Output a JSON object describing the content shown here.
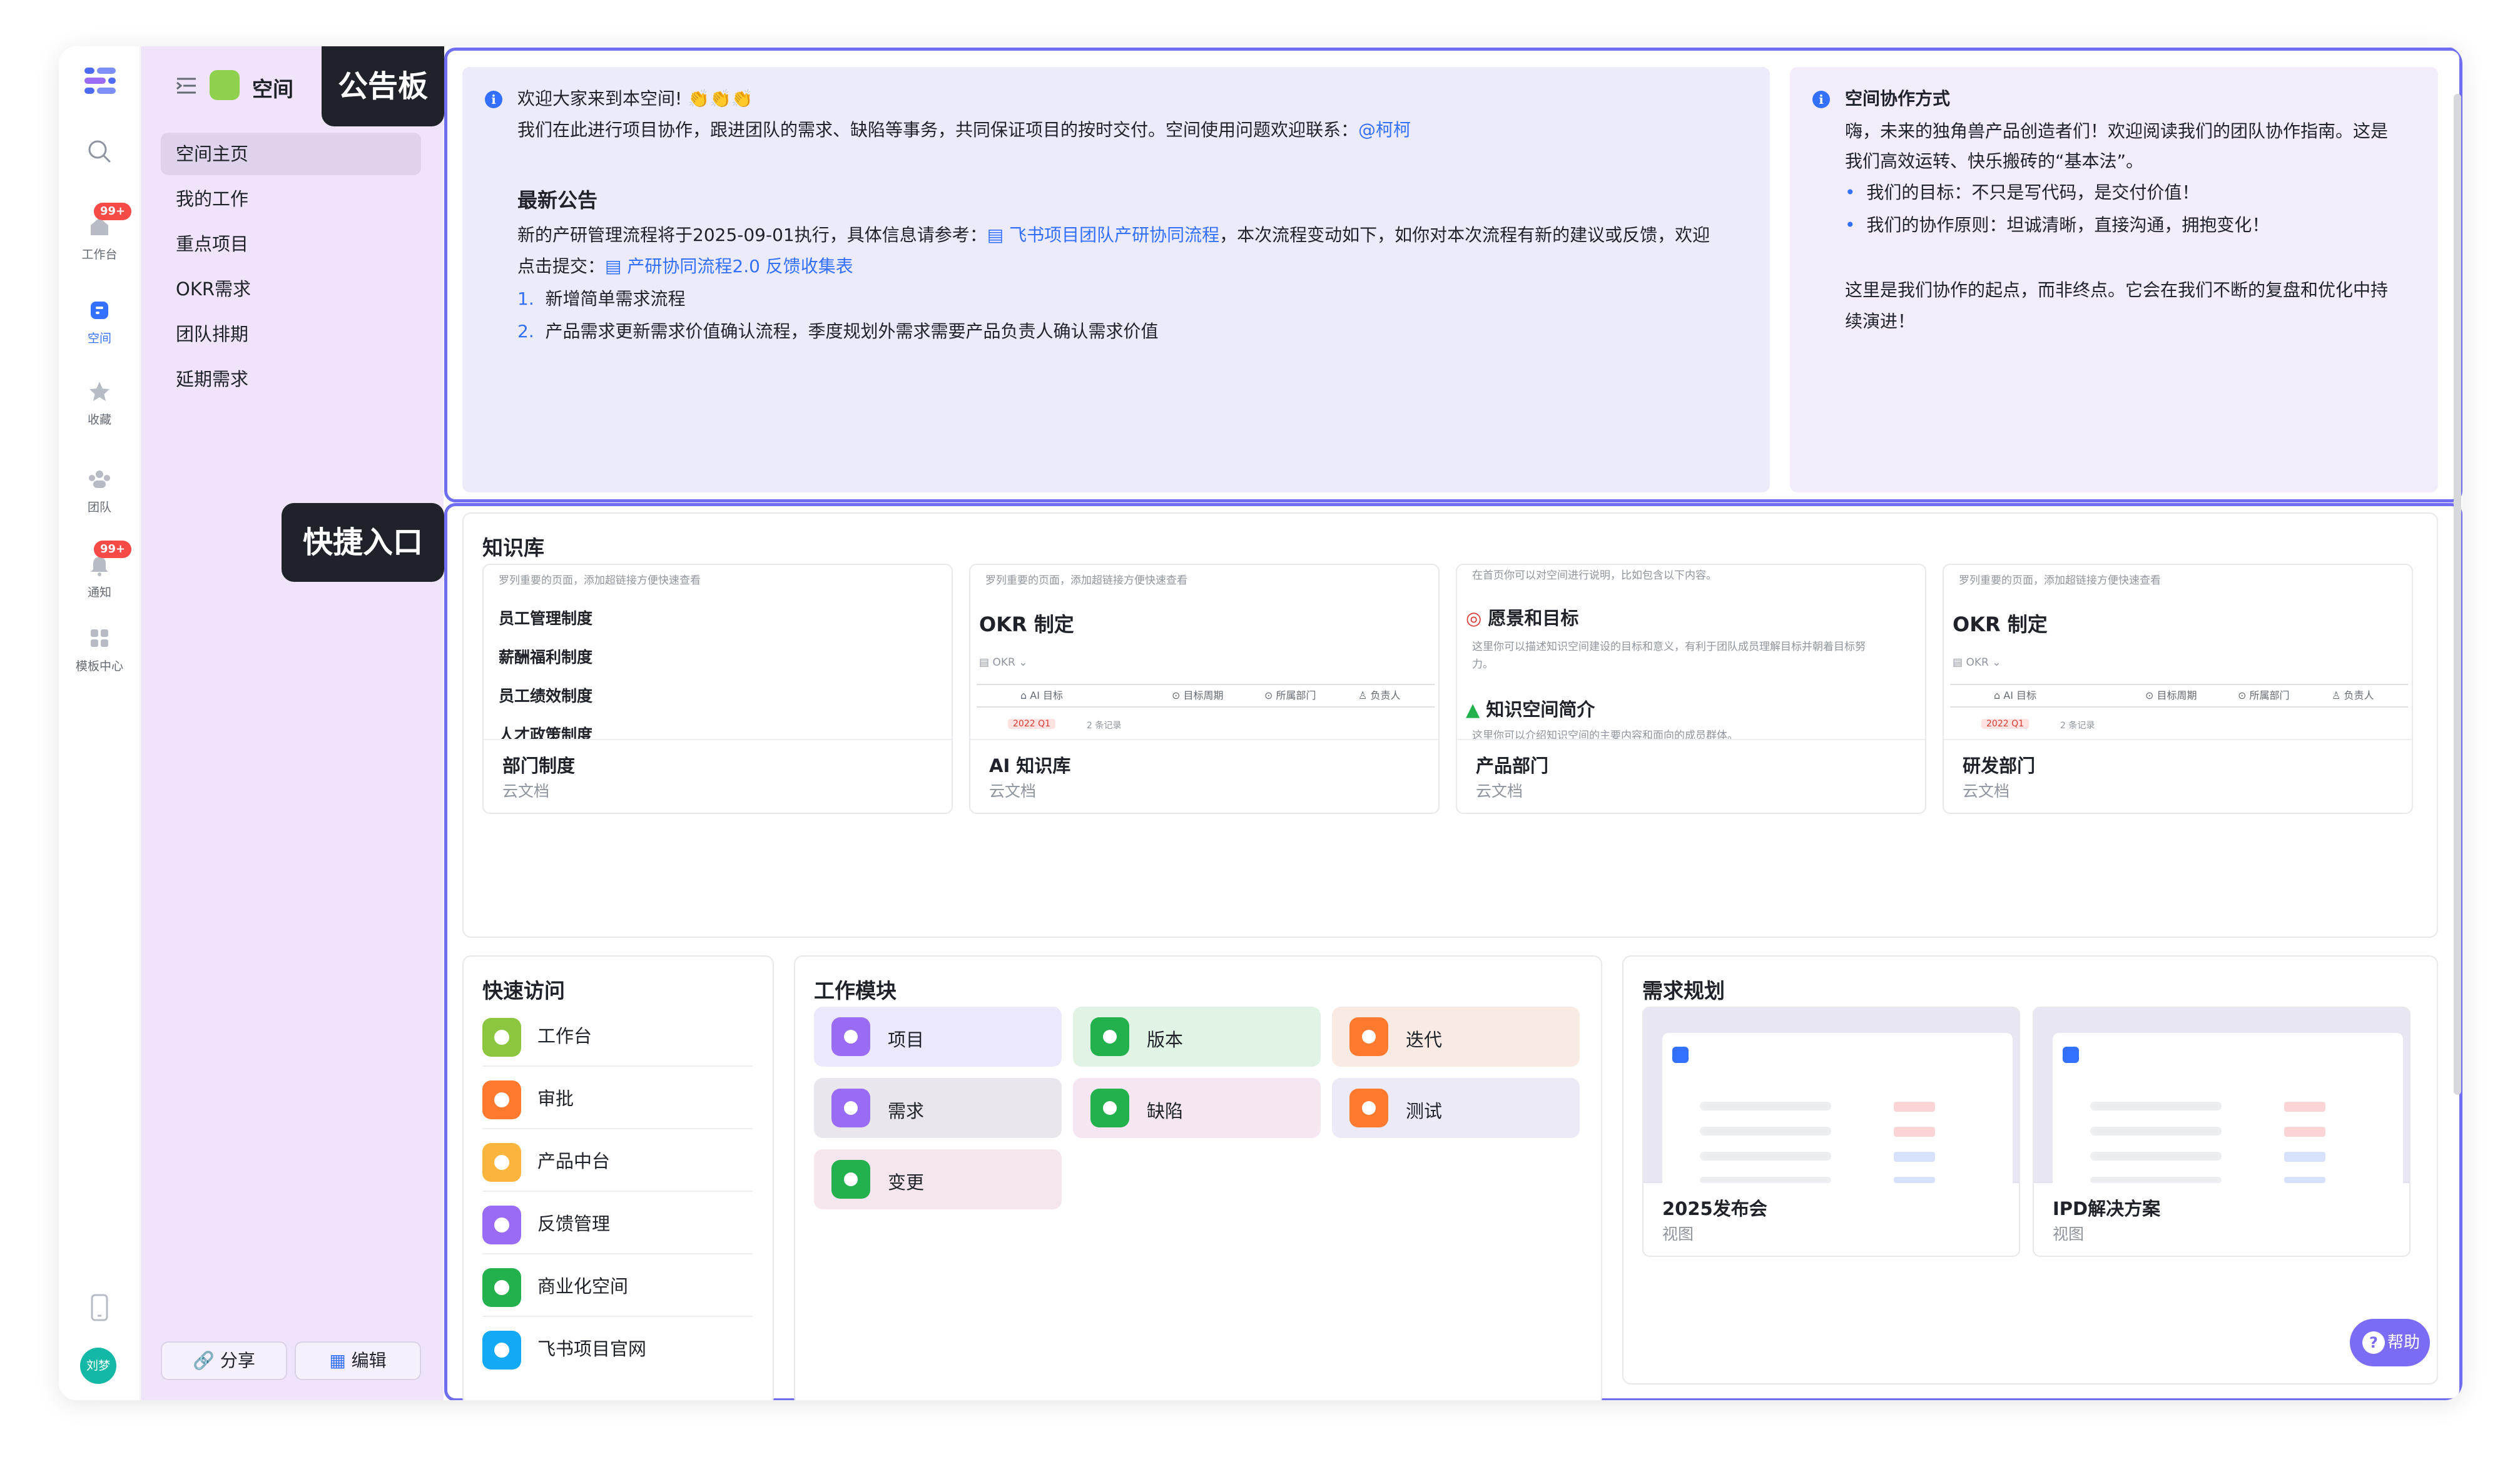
{
  "rail": {
    "items": [
      {
        "label": "工作台",
        "badge": "99+"
      },
      {
        "label": "空间"
      },
      {
        "label": "收藏"
      },
      {
        "label": "团队"
      },
      {
        "label": "通知",
        "badge": "99+"
      },
      {
        "label": "模板中心"
      }
    ],
    "avatar": "刘梦",
    "active_color": "#3370ff"
  },
  "sidebar": {
    "space_name": "空间",
    "items": [
      "空间主页",
      "我的工作",
      "重点项目",
      "OKR需求",
      "团队排期",
      "延期需求"
    ],
    "share_label": "分享",
    "edit_label": "编辑",
    "bg_color": "#efe4f9"
  },
  "tooltips": {
    "board": "公告板",
    "quick": "快捷入口"
  },
  "announcement": {
    "left": {
      "welcome": "欢迎大家来到本空间! 👏👏👏",
      "intro": "我们在此进行项目协作，跟进团队的需求、缺陷等事务，共同保证项目的按时交付。空间使用问题欢迎联系：",
      "contact": "@柯柯",
      "heading": "最新公告",
      "notice_1": "新的产研管理流程将于2025-09-01执行，具体信息请参考：",
      "doc_link": "飞书项目团队产研协同流程",
      "notice_2": "，本次流程变动如下，如你对本次流程有新的建议或反馈，欢迎",
      "notice_3": "点击提交：",
      "form_link": "产研协同流程2.0 反馈收集表",
      "list": [
        {
          "num": "1.",
          "text": "新增简单需求流程"
        },
        {
          "num": "2.",
          "text": "产品需求更新需求价值确认流程，季度规划外需求需要产品负责人确认需求价值"
        }
      ]
    },
    "right": {
      "title": "空间协作方式",
      "p1": "嗨，未来的独角兽产品创造者们！欢迎阅读我们的团队协作指南。这是",
      "p2": "我们高效运转、快乐搬砖的“基本法”。",
      "bullets": [
        "我们的目标：不只是写代码，是交付价值！",
        "我们的协作原则：坦诚清晰，直接沟通，拥抱变化！"
      ],
      "p3": "这里是我们协作的起点，而非终点。它会在我们不断的复盘和优化中持",
      "p4": "续演进！"
    }
  },
  "knowledge": {
    "title": "知识库",
    "cards": [
      {
        "name": "部门制度",
        "type": "云文档",
        "hint": "罗列重要的页面，添加超链接方便快速查看",
        "lines": [
          "员工管理制度",
          "薪酬福利制度",
          "员工绩效制度",
          "人才政策制度"
        ]
      },
      {
        "name": "AI 知识库",
        "type": "云文档",
        "hint": "罗列重要的页面，添加超链接方便快速查看",
        "heading": "OKR 制定",
        "tag": "OKR",
        "cols": [
          "AI 目标",
          "目标周期",
          "所属部门",
          "负责人"
        ],
        "row": "2022 Q1",
        "rowcount": "2 条记录"
      },
      {
        "name": "产品部门",
        "type": "云文档",
        "hint": "在首页你可以对空间进行说明，比如包含以下内容。",
        "h1": "愿景和目标",
        "d1": "这里你可以描述知识空间建设的目标和意义，有利于团队成员理解目标并朝着目标努",
        "d1b": "力。",
        "h2": "知识空间简介",
        "d2": "这里你可以介绍知识空间的主要内容和面向的成员群体。"
      },
      {
        "name": "研发部门",
        "type": "云文档",
        "hint": "罗列重要的页面，添加超链接方便快速查看",
        "heading": "OKR 制定",
        "tag": "OKR",
        "cols": [
          "AI 目标",
          "目标周期",
          "所属部门",
          "负责人"
        ],
        "row": "2022 Q1",
        "rowcount": "2 条记录"
      }
    ]
  },
  "quick_access": {
    "title": "快速访问",
    "items": [
      {
        "label": "工作台",
        "color": "#8cc63f"
      },
      {
        "label": "审批",
        "color": "#ff7a2f"
      },
      {
        "label": "产品中台",
        "color": "#fbb53c"
      },
      {
        "label": "反馈管理",
        "color": "#9a6cf6"
      },
      {
        "label": "商业化空间",
        "color": "#22b14c"
      },
      {
        "label": "飞书项目官网",
        "color": "#14a9f5"
      }
    ]
  },
  "work_modules": {
    "title": "工作模块",
    "items": [
      {
        "label": "项目",
        "color": "#9a6cf6",
        "bg": "#ece8fc"
      },
      {
        "label": "版本",
        "color": "#22b14c",
        "bg": "#e1f3e4"
      },
      {
        "label": "迭代",
        "color": "#ff7a2f",
        "bg": "#f9ebe3"
      },
      {
        "label": "需求",
        "color": "#9a6cf6",
        "bg": "#e9e6ee"
      },
      {
        "label": "缺陷",
        "color": "#22b14c",
        "bg": "#f5e6f2"
      },
      {
        "label": "测试",
        "color": "#ff7a2f",
        "bg": "#eceaf6"
      },
      {
        "label": "变更",
        "color": "#22b14c",
        "bg": "#f5e6ee"
      }
    ]
  },
  "planning": {
    "title": "需求规划",
    "cards": [
      {
        "name": "2025发布会",
        "type": "视图"
      },
      {
        "name": "IPD解决方案",
        "type": "视图"
      }
    ]
  },
  "help_label": "帮助"
}
